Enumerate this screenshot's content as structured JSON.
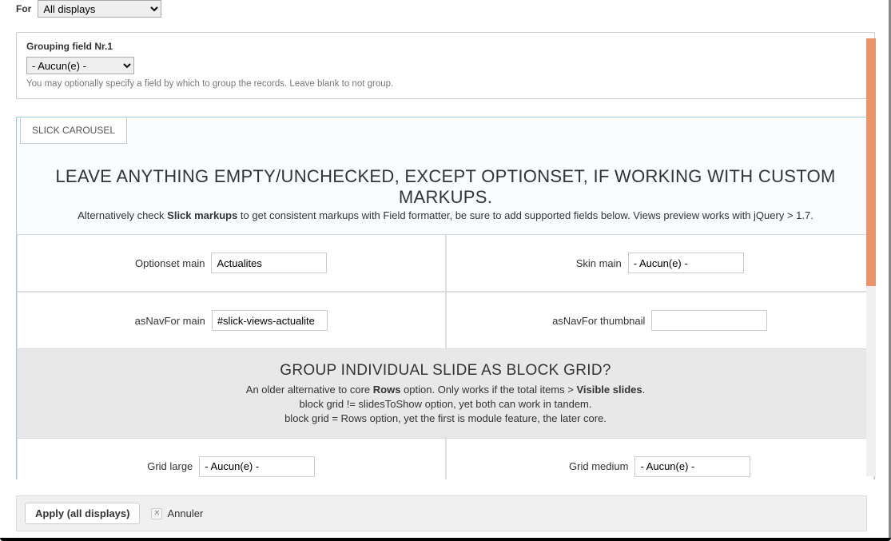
{
  "for": {
    "label": "For",
    "value": "All displays"
  },
  "grouping": {
    "title": "Grouping field Nr.1",
    "value": "- Aucun(e) -",
    "help": "You may optionally specify a field by which to group the records. Leave blank to not group."
  },
  "slick": {
    "tab": "SLICK CAROUSEL",
    "heading": "LEAVE ANYTHING EMPTY/UNCHECKED, EXCEPT OPTIONSET, IF WORKING WITH CUSTOM MARKUPS.",
    "sub_prefix": "Alternatively check ",
    "sub_bold": "Slick markups",
    "sub_suffix": " to get consistent markups with Field formatter, be sure to add supported fields below. Views preview works with jQuery > 1.7.",
    "fields": {
      "optionset_main": {
        "label": "Optionset main",
        "value": "Actualites"
      },
      "skin_main": {
        "label": "Skin main",
        "value": "- Aucun(e) -"
      },
      "asnavfor_main": {
        "label": "asNavFor main",
        "value": "#slick-views-actualite"
      },
      "asnavfor_thumb": {
        "label": "asNavFor thumbnail",
        "value": ""
      },
      "grid_large": {
        "label": "Grid large",
        "value": "- Aucun(e) -"
      },
      "grid_medium": {
        "label": "Grid medium",
        "value": "- Aucun(e) -"
      }
    },
    "grid_note": {
      "title": "GROUP INDIVIDUAL SLIDE AS BLOCK GRID?",
      "line1_a": "An older alternative to core ",
      "line1_b": "Rows",
      "line1_c": " option. Only works if the total items > ",
      "line1_d": "Visible slides",
      "line1_e": ".",
      "line2": "block grid != slidesToShow option, yet both can work in tandem.",
      "line3": "block grid = Rows option, yet the first is module feature, the later core."
    }
  },
  "footer": {
    "apply": "Apply (all displays)",
    "cancel": "Annuler"
  }
}
